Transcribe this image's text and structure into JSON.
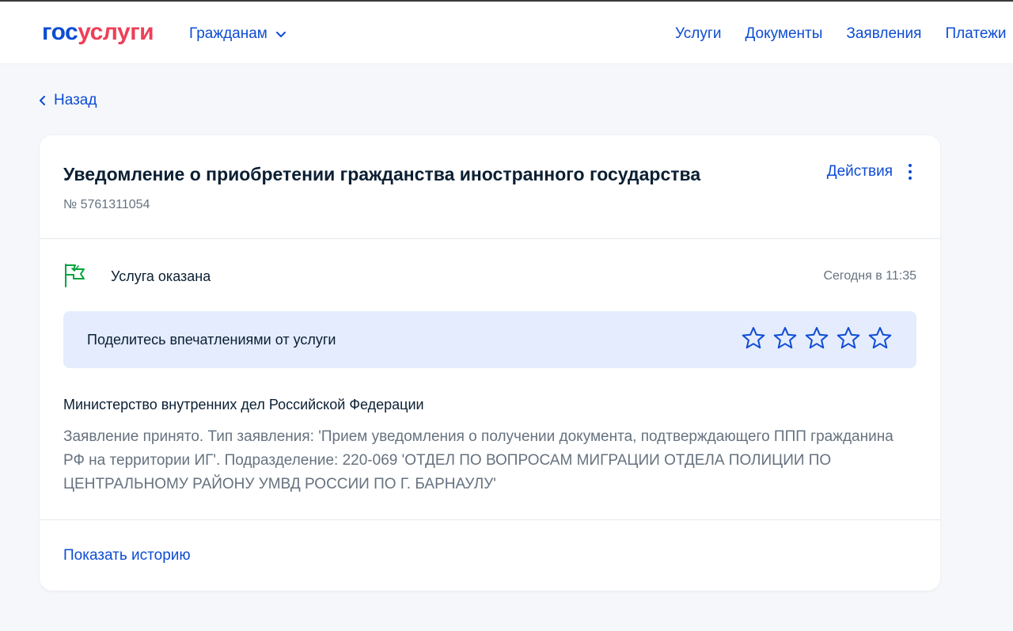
{
  "header": {
    "logo_part1": "гос",
    "logo_part2": "услуги",
    "audience_label": "Гражданам",
    "nav": [
      {
        "label": "Услуги"
      },
      {
        "label": "Документы"
      },
      {
        "label": "Заявления"
      },
      {
        "label": "Платежи"
      }
    ]
  },
  "back_label": "Назад",
  "card": {
    "title": "Уведомление о приобретении гражданства иностранного государства",
    "number": "№ 5761311054",
    "actions_label": "Действия",
    "status": {
      "icon": "flag-icon",
      "text": "Услуга оказана",
      "time": "Сегодня в 11:35"
    },
    "rating": {
      "prompt": "Поделитесь впечатлениями от услуги",
      "max_stars": 5,
      "selected": 0
    },
    "ministry": "Министерство внутренних дел Российской Федерации",
    "description": "Заявление принято. Тип заявления: 'Прием уведомления о получении документа, подтверждающего ППП гражданина РФ на территории ИГ'. Подразделение: 220-069 'ОТДЕЛ ПО ВОПРОСАМ МИГРАЦИИ ОТДЕЛА ПОЛИЦИИ ПО ЦЕНТРАЛЬНОМУ РАЙОНУ УМВД РОССИИ ПО Г. БАРНАУЛУ'",
    "history_label": "Показать историю"
  },
  "colors": {
    "brand_blue": "#0d4cd3",
    "brand_red": "#ee3f58",
    "success_green": "#00a33b",
    "rating_bg": "#e4ecfd",
    "page_bg": "#f5f7fa"
  }
}
